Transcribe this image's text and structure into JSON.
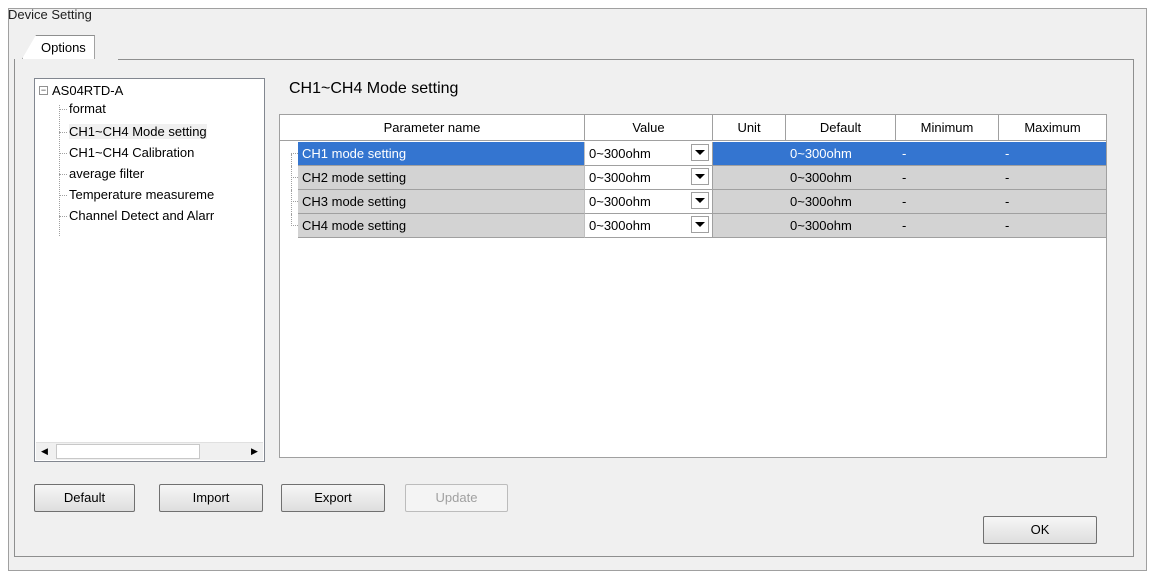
{
  "window": {
    "title": "Device Setting"
  },
  "tabs": [
    {
      "label": "Options"
    }
  ],
  "tree": {
    "root": {
      "expander": "⊟",
      "label": "AS04RTD-A"
    },
    "items": [
      {
        "label": "format"
      },
      {
        "label": "CH1~CH4 Mode setting"
      },
      {
        "label": "CH1~CH4 Calibration"
      },
      {
        "label": "average filter"
      },
      {
        "label": "Temperature measureme"
      },
      {
        "label": "Channel Detect and Alarr"
      }
    ],
    "selected_index": 1
  },
  "section": {
    "title": "CH1~CH4 Mode setting"
  },
  "table": {
    "columns": [
      {
        "label": "Parameter name"
      },
      {
        "label": "Value"
      },
      {
        "label": "Unit"
      },
      {
        "label": "Default"
      },
      {
        "label": "Minimum"
      },
      {
        "label": "Maximum"
      }
    ],
    "rows": [
      {
        "name": "CH1 mode setting",
        "value": "0~300ohm",
        "unit": "",
        "default": "0~300ohm",
        "minimum": "-",
        "maximum": "-"
      },
      {
        "name": "CH2 mode setting",
        "value": "0~300ohm",
        "unit": "",
        "default": "0~300ohm",
        "minimum": "-",
        "maximum": "-"
      },
      {
        "name": "CH3 mode setting",
        "value": "0~300ohm",
        "unit": "",
        "default": "0~300ohm",
        "minimum": "-",
        "maximum": "-"
      },
      {
        "name": "CH4 mode setting",
        "value": "0~300ohm",
        "unit": "",
        "default": "0~300ohm",
        "minimum": "-",
        "maximum": "-"
      }
    ],
    "selected_row": 0
  },
  "buttons": {
    "default": "Default",
    "import": "Import",
    "export": "Export",
    "update": "Update",
    "ok": "OK"
  },
  "colors": {
    "selection": "#3475d0",
    "row_background": "#d3d3d3",
    "window_background": "#f0f0f0"
  }
}
